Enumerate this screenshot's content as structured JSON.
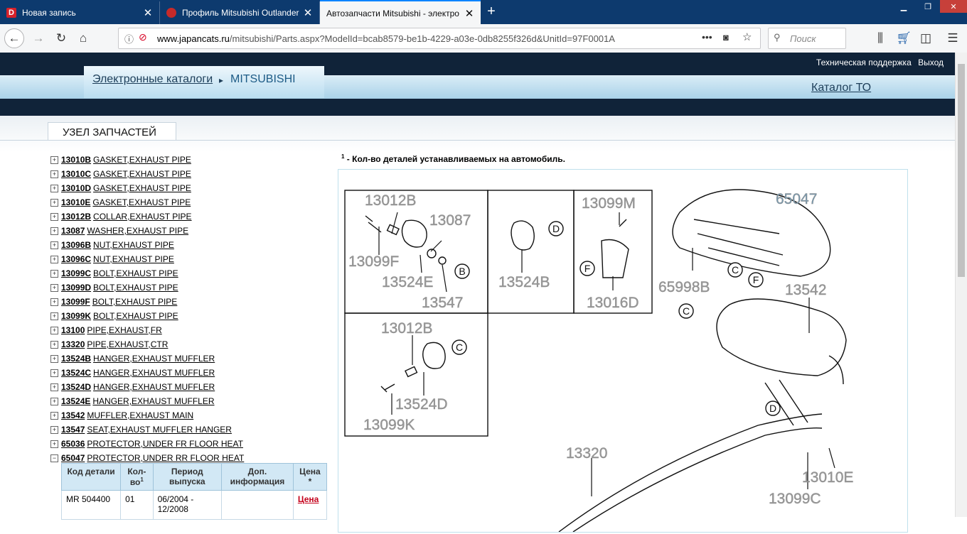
{
  "browser": {
    "tabs": [
      {
        "title": "Новая запись",
        "favicon_letter": "D"
      },
      {
        "title": "Профиль Mitsubishi Outlander",
        "favicon_letter": ""
      },
      {
        "title": "Автозапчасти Mitsubishi - электро",
        "favicon_letter": ""
      }
    ],
    "url_prefix": "www.japancats.ru",
    "url_rest": "/mitsubishi/Parts.aspx?ModelId=bcab8579-be1b-4229-a03e-0db8255f326d&UnitId=97F0001A",
    "search_placeholder": "Поиск"
  },
  "header": {
    "support": "Техническая поддержка",
    "logout": "Выход",
    "breadcrumb_catalogs": "Электронные каталоги",
    "breadcrumb_sep": "▸",
    "breadcrumb_brand": "MITSUBISHI",
    "catalog_to": "Каталог ТО"
  },
  "section_tab": "УЗЕЛ ЗАПЧАСТЕЙ",
  "parts": [
    {
      "code": "13010B",
      "desc": "GASKET,EXHAUST PIPE",
      "expanded": false
    },
    {
      "code": "13010C",
      "desc": "GASKET,EXHAUST PIPE",
      "expanded": false
    },
    {
      "code": "13010D",
      "desc": "GASKET,EXHAUST PIPE",
      "expanded": false
    },
    {
      "code": "13010E",
      "desc": "GASKET,EXHAUST PIPE",
      "expanded": false
    },
    {
      "code": "13012B",
      "desc": "COLLAR,EXHAUST PIPE",
      "expanded": false
    },
    {
      "code": "13087",
      "desc": "WASHER,EXHAUST PIPE",
      "expanded": false
    },
    {
      "code": "13096B",
      "desc": "NUT,EXHAUST PIPE",
      "expanded": false
    },
    {
      "code": "13096C",
      "desc": "NUT,EXHAUST PIPE",
      "expanded": false
    },
    {
      "code": "13099C",
      "desc": "BOLT,EXHAUST PIPE",
      "expanded": false
    },
    {
      "code": "13099D",
      "desc": "BOLT,EXHAUST PIPE",
      "expanded": false
    },
    {
      "code": "13099F",
      "desc": "BOLT,EXHAUST PIPE",
      "expanded": false
    },
    {
      "code": "13099K",
      "desc": "BOLT,EXHAUST PIPE",
      "expanded": false
    },
    {
      "code": "13100",
      "desc": "PIPE,EXHAUST,FR",
      "expanded": false
    },
    {
      "code": "13320",
      "desc": "PIPE,EXHAUST,CTR",
      "expanded": false
    },
    {
      "code": "13524B",
      "desc": "HANGER,EXHAUST MUFFLER",
      "expanded": false
    },
    {
      "code": "13524C",
      "desc": "HANGER,EXHAUST MUFFLER",
      "expanded": false
    },
    {
      "code": "13524D",
      "desc": "HANGER,EXHAUST MUFFLER",
      "expanded": false
    },
    {
      "code": "13524E",
      "desc": "HANGER,EXHAUST MUFFLER",
      "expanded": false
    },
    {
      "code": "13542",
      "desc": "MUFFLER,EXHAUST MAIN",
      "expanded": false
    },
    {
      "code": "13547",
      "desc": "SEAT,EXHAUST MUFFLER HANGER",
      "expanded": false
    },
    {
      "code": "65036",
      "desc": "PROTECTOR,UNDER FR FLOOR HEAT",
      "expanded": false
    },
    {
      "code": "65047",
      "desc": "PROTECTOR,UNDER RR FLOOR HEAT",
      "expanded": true
    }
  ],
  "detail_table": {
    "headers": [
      "Код детали",
      "Кол-во",
      "1",
      "Период выпуска",
      "Доп. информация",
      "Цена",
      "*"
    ],
    "row": {
      "code": "MR 504400",
      "qty": "01",
      "period": "06/2004 - 12/2008",
      "info": "",
      "price": "Цена"
    }
  },
  "footnote": {
    "sup": "1",
    "text": " - Кол-во деталей устанавливаемых на автомобиль."
  },
  "diagram": {
    "labels": [
      "13012B",
      "13087",
      "13099F",
      "13524E",
      "13547",
      "13524B",
      "13099M",
      "13016D",
      "13012B",
      "13524D",
      "13099K",
      "65047",
      "65998B",
      "13542",
      "13320",
      "13010E",
      "13099C"
    ],
    "callouts": [
      "B",
      "D",
      "F",
      "C",
      "C",
      "F",
      "C",
      "D"
    ]
  }
}
